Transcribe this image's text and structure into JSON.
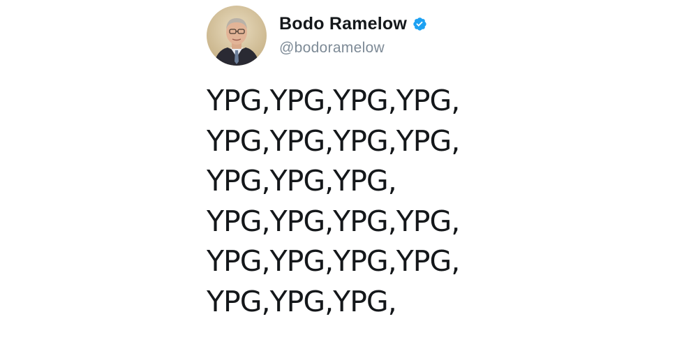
{
  "tweet": {
    "author": {
      "display_name": "Bodo Ramelow",
      "handle": "@bodoramelow",
      "verified": true,
      "avatar_icon": "profile-photo-icon",
      "verified_icon": "verified-badge-icon"
    },
    "lines": [
      "YPG,YPG,YPG,YPG,",
      "YPG,YPG,YPG,YPG,",
      "YPG,YPG,YPG,",
      "YPG,YPG,YPG,YPG,",
      "YPG,YPG,YPG,YPG,",
      "YPG,YPG,YPG,"
    ]
  },
  "colors": {
    "text": "#14171a",
    "handle": "#7d8a96",
    "verified_blue": "#1da1f2",
    "background": "#ffffff"
  }
}
